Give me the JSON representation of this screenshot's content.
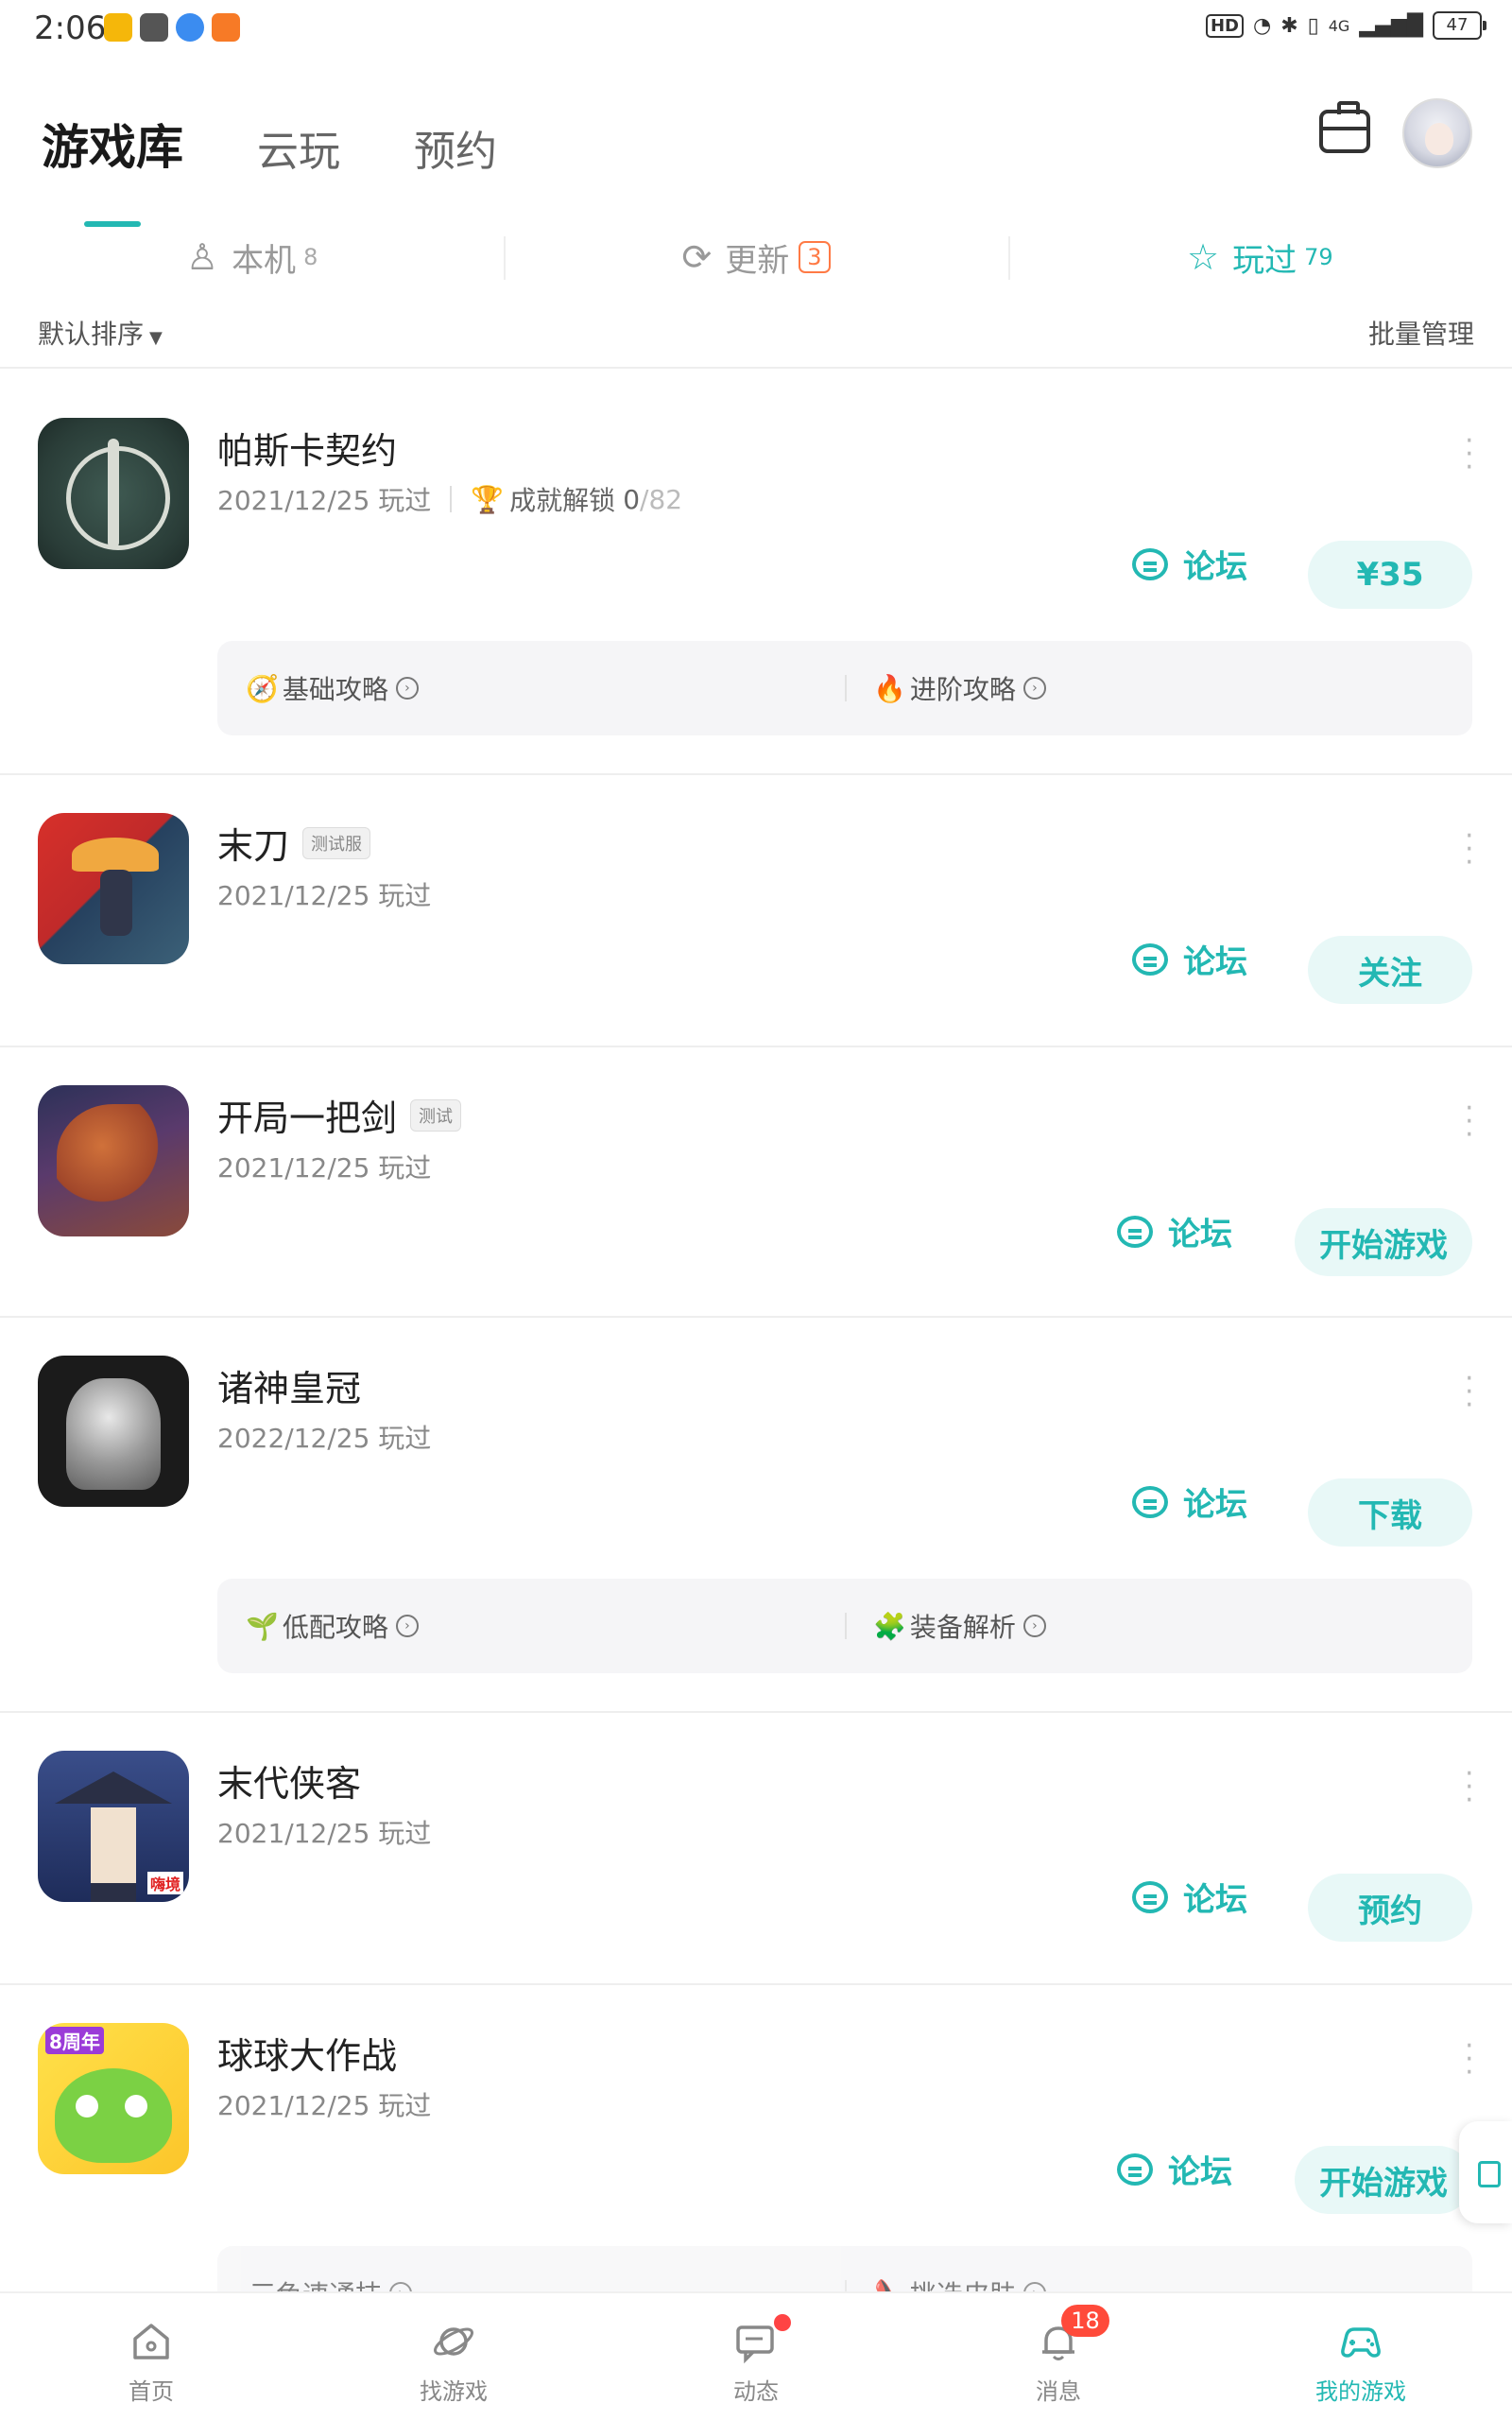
{
  "status_bar": {
    "time": "2:06",
    "network": "4G",
    "battery": "47",
    "hd": "HD"
  },
  "top_tabs": [
    "游戏库",
    "云玩",
    "预约"
  ],
  "sub_tabs": {
    "local": {
      "label": "本机",
      "count": "8"
    },
    "update": {
      "label": "更新",
      "count": "3"
    },
    "played": {
      "label": "玩过",
      "count": "79"
    }
  },
  "sort": {
    "label": "默认排序",
    "batch": "批量管理"
  },
  "forum_label": "论坛",
  "games": [
    {
      "title": "帕斯卡契约",
      "tag": "",
      "played": "2021/12/25 玩过",
      "achievement": {
        "label": "成就解锁",
        "done": "0",
        "total": "82"
      },
      "action": "¥35",
      "guides": [
        {
          "emoji": "🧭",
          "label": "基础攻略"
        },
        {
          "emoji": "🔥",
          "label": "进阶攻略"
        }
      ]
    },
    {
      "title": "末刀",
      "tag": "测试服",
      "played": "2021/12/25 玩过",
      "action": "关注"
    },
    {
      "title": "开局一把剑",
      "tag": "测试",
      "played": "2021/12/25 玩过",
      "action": "开始游戏"
    },
    {
      "title": "诸神皇冠",
      "tag": "",
      "played": "2022/12/25 玩过",
      "action": "下载",
      "guides": [
        {
          "emoji": "🌱",
          "label": "低配攻略"
        },
        {
          "emoji": "🧩",
          "label": "装备解析"
        }
      ]
    },
    {
      "title": "末代侠客",
      "tag": "",
      "played": "2021/12/25 玩过",
      "icon_overlay": "嗨境",
      "action": "预约"
    },
    {
      "title": "球球大作战",
      "tag": "",
      "played": "2021/12/25 玩过",
      "icon_overlay": "8周年",
      "action": "开始游戏",
      "guides": [
        {
          "emoji": "",
          "label": "三色速通技"
        },
        {
          "emoji": "👠",
          "label": "挑选皮肤"
        }
      ]
    }
  ],
  "bottom_nav": [
    {
      "label": "首页",
      "icon": "home-icon"
    },
    {
      "label": "找游戏",
      "icon": "planet-icon"
    },
    {
      "label": "动态",
      "icon": "chat-icon"
    },
    {
      "label": "消息",
      "icon": "bell-icon",
      "badge": "18"
    },
    {
      "label": "我的游戏",
      "icon": "gamepad-icon"
    }
  ],
  "colors": {
    "accent": "#23b8b3",
    "accent_bg": "#e8f8f7",
    "badge": "#ff4a3a",
    "update": "#ff7a45"
  }
}
